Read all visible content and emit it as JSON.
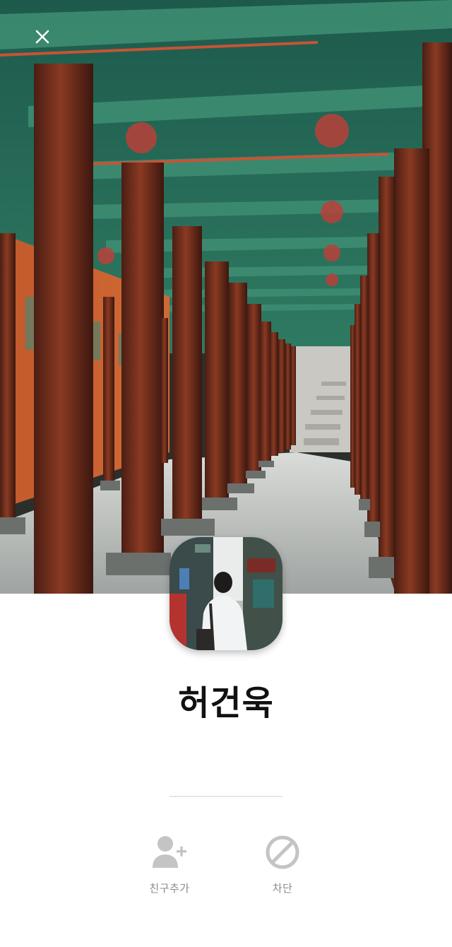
{
  "profile": {
    "name": "허건욱"
  },
  "actions": {
    "add_friend": {
      "label": "친구추가",
      "icon": "add-user-icon"
    },
    "block": {
      "label": "차단",
      "icon": "block-icon"
    }
  },
  "header": {
    "close_icon": "close-icon"
  },
  "colors": {
    "icon_gray": "#c4c4c4",
    "label_gray": "#8c8c8c",
    "name_text": "#111111",
    "divider": "#e6e6e6"
  }
}
